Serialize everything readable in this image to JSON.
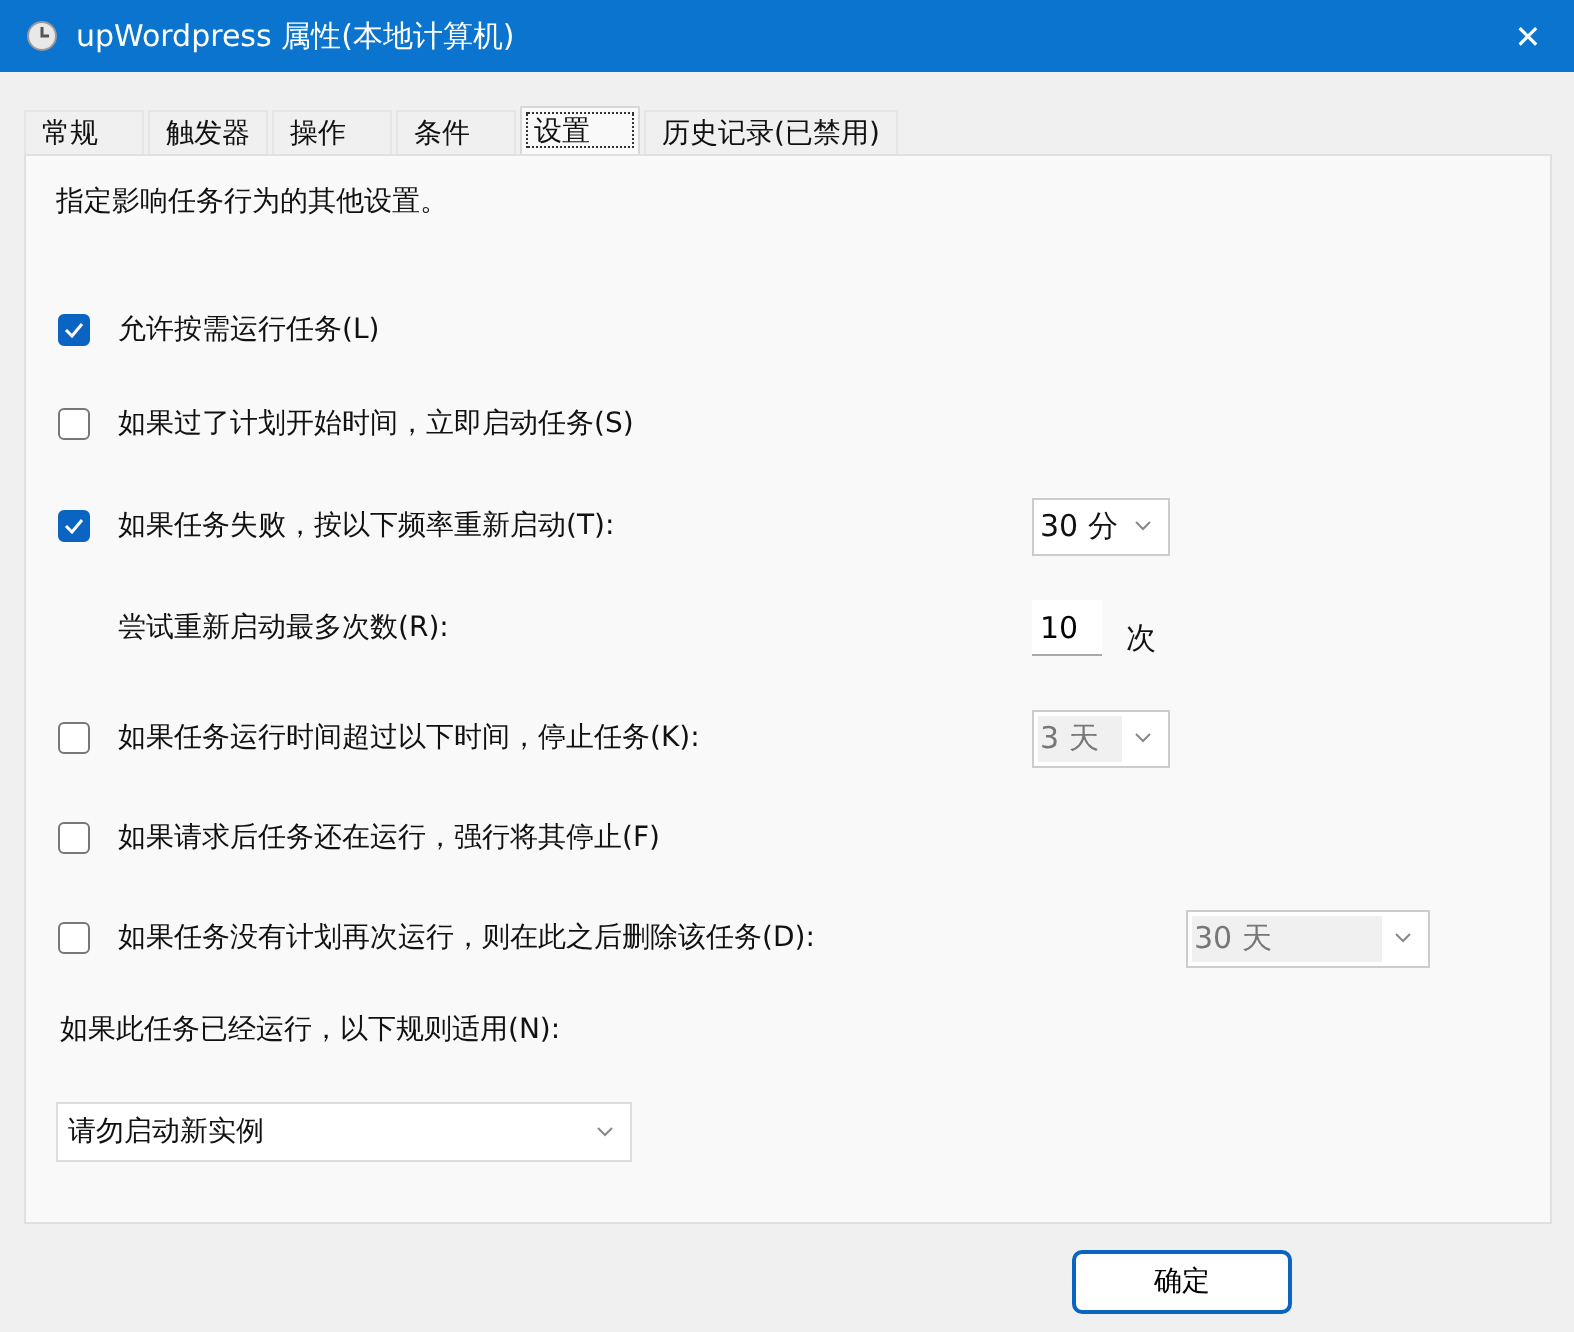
{
  "window": {
    "title": "upWordpress 属性(本地计算机)",
    "close": "✕"
  },
  "tabs": [
    {
      "label": "常规",
      "selected": false
    },
    {
      "label": "触发器",
      "selected": false
    },
    {
      "label": "操作",
      "selected": false
    },
    {
      "label": "条件",
      "selected": false
    },
    {
      "label": "设置",
      "selected": true
    },
    {
      "label": "历史记录(已禁用)",
      "selected": false
    }
  ],
  "description": "指定影响任务行为的其他设置。",
  "settings": [
    {
      "kind": "checkbox",
      "label": "允许按需运行任务(L)",
      "checked": true
    },
    {
      "kind": "checkbox",
      "label": "如果过了计划开始时间，立即启动任务(S)",
      "checked": false
    },
    {
      "kind": "checkbox",
      "label": "如果任务失败，按以下频率重新启动(T):",
      "checked": true,
      "control": {
        "kind": "dropdown",
        "value": "30 分",
        "disabled": false
      }
    },
    {
      "kind": "label",
      "label": "尝试重新启动最多次数(R):",
      "control": {
        "kind": "number",
        "value": "10",
        "unit": "次"
      }
    },
    {
      "kind": "checkbox",
      "label": "如果任务运行时间超过以下时间，停止任务(K):",
      "checked": false,
      "control": {
        "kind": "dropdown",
        "value": "3 天",
        "disabled": true
      }
    },
    {
      "kind": "checkbox",
      "label": "如果请求后任务还在运行，强行将其停止(F)",
      "checked": false
    },
    {
      "kind": "checkbox",
      "label": "如果任务没有计划再次运行，则在此之后删除该任务(D):",
      "checked": false,
      "control": {
        "kind": "wide-dropdown",
        "value": "30 天",
        "disabled": true
      }
    }
  ],
  "rule": {
    "label": "如果此任务已经运行，以下规则适用(N):",
    "value": "请勿启动新实例"
  },
  "buttons": [
    {
      "label": "确定",
      "selected": true
    }
  ]
}
